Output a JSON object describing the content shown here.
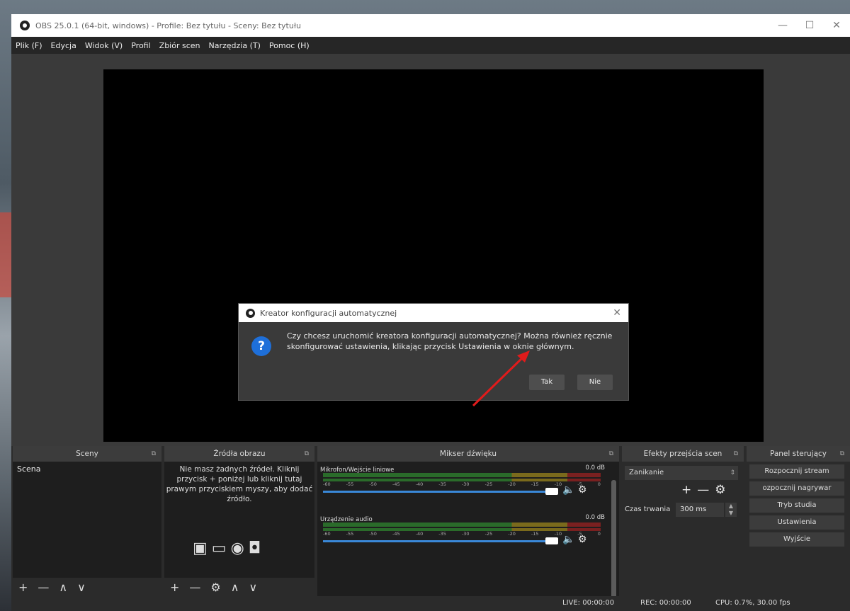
{
  "window": {
    "title": "OBS 25.0.1 (64-bit, windows) - Profile: Bez tytułu - Sceny: Bez tytułu",
    "controls": [
      "—",
      "☐",
      "✕"
    ]
  },
  "menu": [
    "Plik (F)",
    "Edycja",
    "Widok (V)",
    "Profil",
    "Zbiór scen",
    "Narzędzia (T)",
    "Pomoc (H)"
  ],
  "dialog": {
    "title": "Kreator konfiguracji automatycznej",
    "close": "✕",
    "icon": "?",
    "message": "Czy chcesz uruchomić kreatora konfiguracji automatycznej? Można również ręcznie skonfigurować ustawienia, klikając przycisk Ustawienia w oknie głównym.",
    "yes": "Tak",
    "no": "Nie"
  },
  "docks": {
    "scenes": {
      "title": "Sceny",
      "items": [
        "Scena"
      ],
      "footer": [
        "+",
        "—",
        "∧",
        "∨"
      ]
    },
    "sources": {
      "title": "Źródła obrazu",
      "empty_message": "Nie masz żadnych źródeł. Kliknij przycisk + poniżej lub kliknij tutaj prawym przyciskiem myszy, aby dodać źródło.",
      "footer": [
        "+",
        "—",
        "⚙",
        "∧",
        "∨"
      ]
    },
    "mixer": {
      "title": "Mikser dźwięku",
      "tracks": [
        {
          "name": "Mikrofon/Wejście liniowe",
          "db": "0.0 dB",
          "volume": 1.0
        },
        {
          "name": "Urządzenie audio",
          "db": "0.0 dB",
          "volume": 1.0
        }
      ],
      "scale": [
        "-60",
        "-55",
        "-50",
        "-45",
        "-40",
        "-35",
        "-30",
        "-25",
        "-20",
        "-15",
        "-10",
        "-5",
        "0"
      ]
    },
    "transitions": {
      "title": "Efekty przejścia scen",
      "selected": "Zanikanie",
      "duration_label": "Czas trwania",
      "duration": "300 ms"
    },
    "controls": {
      "title": "Panel sterujący",
      "buttons": [
        "Rozpocznij stream",
        "ozpocznij nagrywar",
        "Tryb studia",
        "Ustawienia",
        "Wyjście"
      ]
    }
  },
  "status": {
    "live": "LIVE: 00:00:00",
    "rec": "REC: 00:00:00",
    "cpu": "CPU: 0.7%, 30.00 fps"
  },
  "colors": {
    "accent_blue": "#1e6fd9",
    "annotation_arrow": "#e11b1b"
  }
}
